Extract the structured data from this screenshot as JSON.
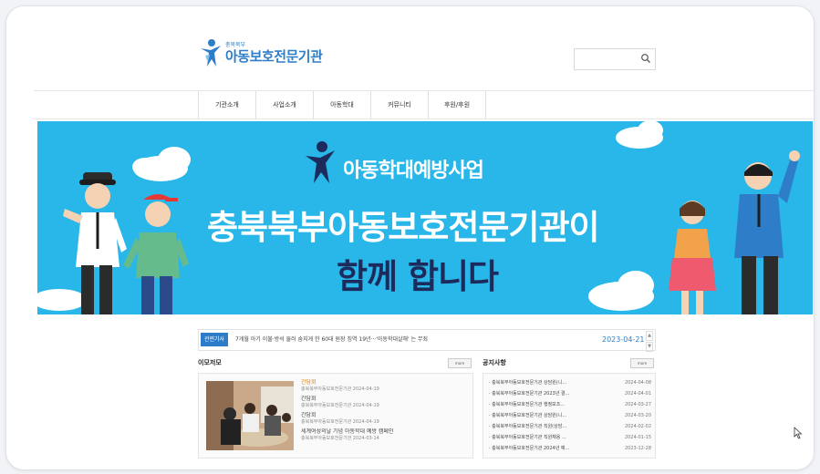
{
  "logo": {
    "sub": "충북북부",
    "main": "아동보호전문기관"
  },
  "search": {
    "value": "",
    "placeholder": ""
  },
  "nav": {
    "items": [
      "기관소개",
      "사업소개",
      "아동학대",
      "커뮤니티",
      "후원/후원"
    ]
  },
  "banner": {
    "subtitle": "아동학대예방사업",
    "title": "충북북부아동보호전문기관",
    "title_suffix": "이",
    "title2": "함께 합니다"
  },
  "ticker": {
    "badge": "관련기사",
    "text": "7개월 아기 이불·방석 둘러 숨지게 한 60대 원장 징역 19년···'아동학대살해' 는 무죄",
    "date": "2023-04-21",
    "up": "▲",
    "down": "▼"
  },
  "photo_panel": {
    "title": "이모저모",
    "more": "more",
    "items": [
      {
        "title": "간담회",
        "meta": "충북북부아동보호전문기관  2024-04-19",
        "highlight": true
      },
      {
        "title": "간담회",
        "meta": "충북북부아동보호전문기관  2024-04-19",
        "highlight": false
      },
      {
        "title": "간담회",
        "meta": "충북북부아동보호전문기관  2024-04-19",
        "highlight": false
      },
      {
        "title": "세계여성의날 기념 아동학대 예방 캠페인",
        "meta": "충북북부아동보호전문기관  2024-03-14",
        "highlight": false
      }
    ]
  },
  "notice_panel": {
    "title": "공지사항",
    "more": "more",
    "items": [
      {
        "title": "· 충북북부아동보호전문기관 상담원(니...",
        "date": "2024-04-08"
      },
      {
        "title": "· 충북북부아동보호전문기관 2023년 결...",
        "date": "2024-04-01"
      },
      {
        "title": "· 충북북부아동보호전문기관 행정보조...",
        "date": "2024-03-27"
      },
      {
        "title": "· 충북북부아동보호전문기관 상담원(니...",
        "date": "2024-03-20"
      },
      {
        "title": "· 충북북부아동보호전문기관 직원(상담...",
        "date": "2024-02-02"
      },
      {
        "title": "· 충북북부아동보호전문기관 직원채용 ...",
        "date": "2024-01-15"
      },
      {
        "title": "· 충북북부아동보호전문기관 2024년 예...",
        "date": "2023-12-28"
      }
    ]
  },
  "colors": {
    "brand": "#2e7dc8",
    "banner": "#29b6e8",
    "accent": "#e07b1a"
  }
}
